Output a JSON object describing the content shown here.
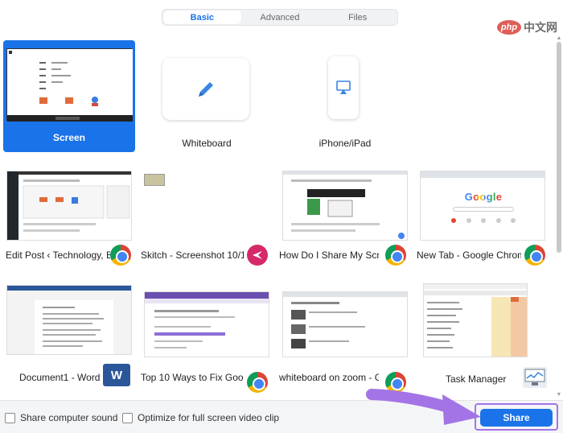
{
  "tabs": [
    {
      "label": "Basic",
      "active": true
    },
    {
      "label": "Advanced",
      "active": false
    },
    {
      "label": "Files",
      "active": false
    }
  ],
  "watermark": {
    "logo_text": "php",
    "text": "中文网"
  },
  "sources": {
    "screen": {
      "label": "Screen",
      "selected": true
    },
    "whiteboard": {
      "label": "Whiteboard",
      "icon": "pencil-icon"
    },
    "iphone": {
      "label": "iPhone/iPad",
      "icon": "airplay-icon"
    }
  },
  "windows": [
    {
      "label": "Edit Post ‹ Technology, B...",
      "icon": "chrome-icon"
    },
    {
      "label": "Skitch - Screenshot 10/1...",
      "icon": "skitch-icon"
    },
    {
      "label": "How Do I Share My Scre...",
      "icon": "chrome-icon"
    },
    {
      "label": "New Tab - Google Chrome",
      "icon": "chrome-icon"
    },
    {
      "label": "Document1 - Word",
      "icon": "word-icon"
    },
    {
      "label": "Top 10 Ways to Fix Goog...",
      "icon": "chrome-icon"
    },
    {
      "label": "whiteboard on zoom - G...",
      "icon": "chrome-icon"
    },
    {
      "label": "Task Manager",
      "icon": "task-manager-icon"
    }
  ],
  "thumb_text": {
    "google_logo": "Google",
    "word_icon_letter": "W"
  },
  "options": {
    "share_sound": "Share computer sound",
    "optimize_video": "Optimize for full screen video clip"
  },
  "share_label": "Share",
  "colors": {
    "accent": "#1a73e8",
    "highlight": "#a374e6"
  }
}
